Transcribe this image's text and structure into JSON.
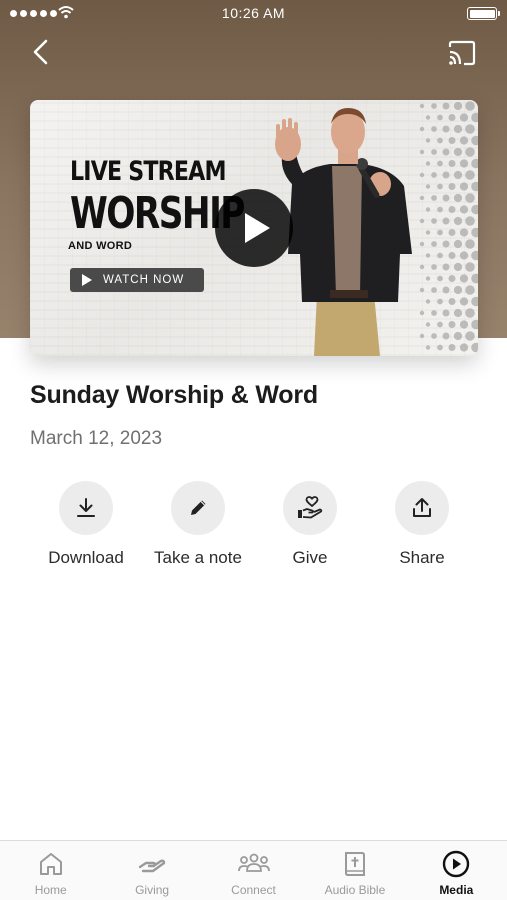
{
  "status_bar": {
    "time": "10:26 AM",
    "signal_icon": "signal-dots-icon",
    "wifi_icon": "wifi-icon",
    "battery_icon": "battery-icon"
  },
  "header": {
    "back_icon": "chevron-left-icon",
    "cast_icon": "cast-icon"
  },
  "video": {
    "thumbnail_line1": "LIVE STREAM",
    "thumbnail_line2": "WORSHIP",
    "thumbnail_line3": "AND WORD",
    "watch_label": "WATCH NOW",
    "play_icon": "play-icon"
  },
  "sermon": {
    "title": "Sunday Worship & Word",
    "date": "March 12, 2023"
  },
  "actions": [
    {
      "label": "Download",
      "icon": "download-icon"
    },
    {
      "label": "Take a note",
      "icon": "pencil-icon"
    },
    {
      "label": "Give",
      "icon": "heart-hand-icon"
    },
    {
      "label": "Share",
      "icon": "share-icon"
    }
  ],
  "tabs": [
    {
      "label": "Home",
      "icon": "home-icon",
      "active": false
    },
    {
      "label": "Giving",
      "icon": "giving-hand-icon",
      "active": false
    },
    {
      "label": "Connect",
      "icon": "people-group-icon",
      "active": false
    },
    {
      "label": "Audio Bible",
      "icon": "bible-icon",
      "active": false
    },
    {
      "label": "Media",
      "icon": "play-circle-icon",
      "active": true
    }
  ],
  "colors": {
    "hero_background": "#7d6a55",
    "action_circle": "#ececec",
    "tab_active": "#111111",
    "tab_inactive": "#9a9a9a"
  }
}
